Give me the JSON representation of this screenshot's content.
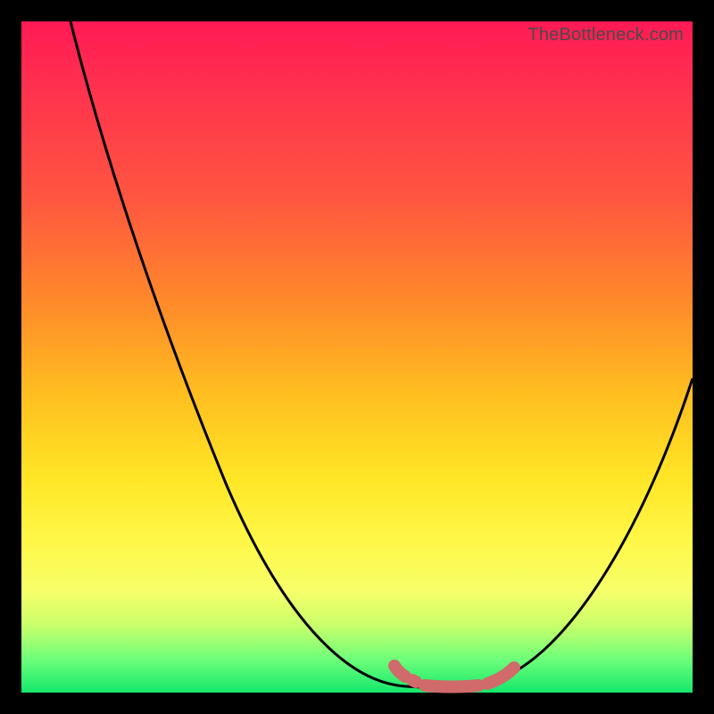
{
  "attribution": "TheBottleneck.com",
  "colors": {
    "background": "#000000",
    "gradient_top": "#ff1a55",
    "gradient_mid1": "#ff8a2a",
    "gradient_mid2": "#ffe626",
    "gradient_bottom": "#14e86b",
    "curve_stroke": "#000000",
    "bottom_mark": "#d16a6a"
  },
  "chart_data": {
    "type": "line",
    "title": "",
    "xlabel": "",
    "ylabel": "",
    "xrange": [
      0,
      100
    ],
    "yrange": [
      0,
      100
    ],
    "x": [
      0,
      5,
      10,
      15,
      20,
      25,
      30,
      35,
      40,
      45,
      50,
      55,
      60,
      65,
      70,
      75,
      80,
      85,
      90,
      95,
      100
    ],
    "series": [
      {
        "name": "bottleneck_curve",
        "values": [
          100,
          94,
          86,
          78,
          69,
          59,
          49,
          39,
          29,
          19,
          10,
          4,
          1,
          0,
          0,
          2,
          8,
          17,
          28,
          39,
          47
        ]
      }
    ],
    "valley_segment": {
      "x": [
        54,
        58,
        60,
        63,
        66,
        69,
        72
      ],
      "y": [
        3.4,
        1.5,
        0.9,
        0.6,
        0.6,
        0.8,
        1.9
      ],
      "color": "#d16a6a"
    }
  }
}
